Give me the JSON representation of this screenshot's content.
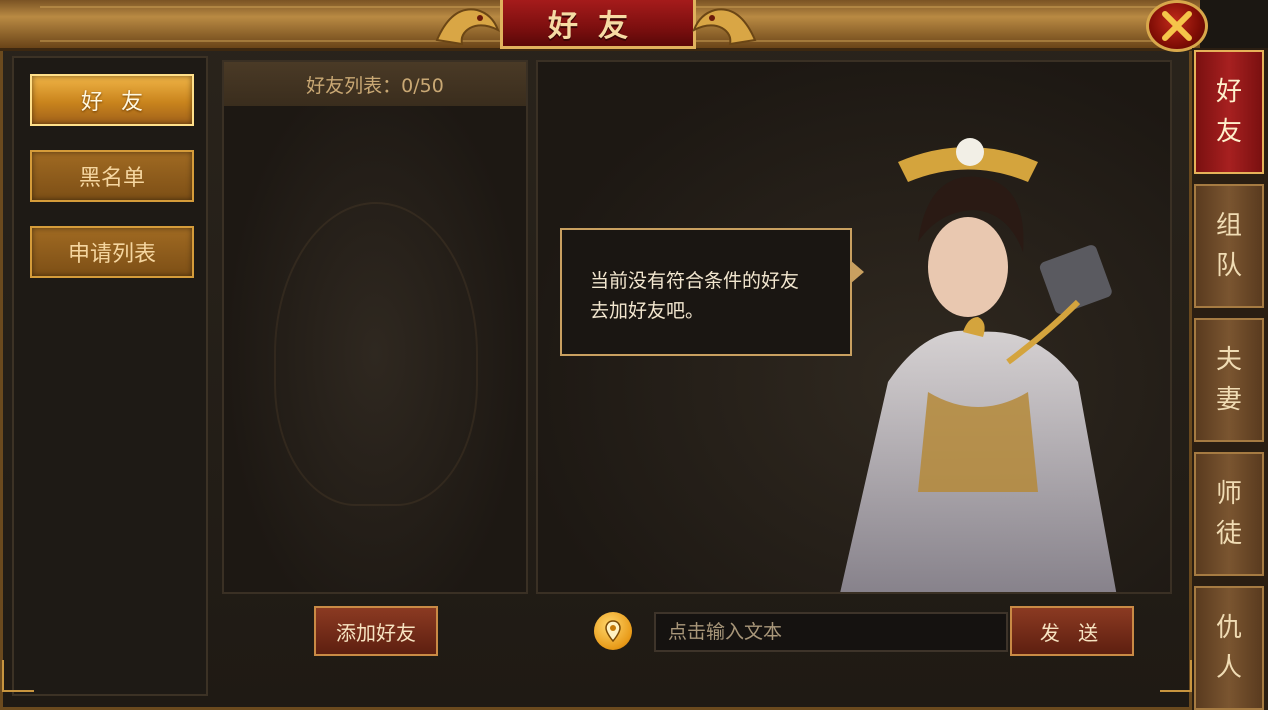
{
  "header": {
    "title": "好友"
  },
  "left_tabs": [
    {
      "label": "好友",
      "active": true
    },
    {
      "label": "黑名单",
      "active": false
    },
    {
      "label": "申请列表",
      "active": false
    }
  ],
  "friend_list": {
    "header": "好友列表：0/50"
  },
  "chat": {
    "empty_line1": "当前没有符合条件的好友",
    "empty_line2": "去加好友吧。"
  },
  "controls": {
    "add_friend_label": "添加好友",
    "input_placeholder": "点击输入文本",
    "send_label": "发 送",
    "location_icon": "location-pin-icon"
  },
  "side_tabs": [
    {
      "chars": [
        "好",
        "友"
      ],
      "active": true
    },
    {
      "chars": [
        "组",
        "队"
      ],
      "active": false
    },
    {
      "chars": [
        "夫",
        "妻"
      ],
      "active": false
    },
    {
      "chars": [
        "师",
        "徒"
      ],
      "active": false
    },
    {
      "chars": [
        "仇",
        "人"
      ],
      "active": false
    }
  ],
  "colors": {
    "accent_gold": "#d59c3a",
    "title_red": "#a51b1b",
    "bubble_border": "#c9a060"
  }
}
